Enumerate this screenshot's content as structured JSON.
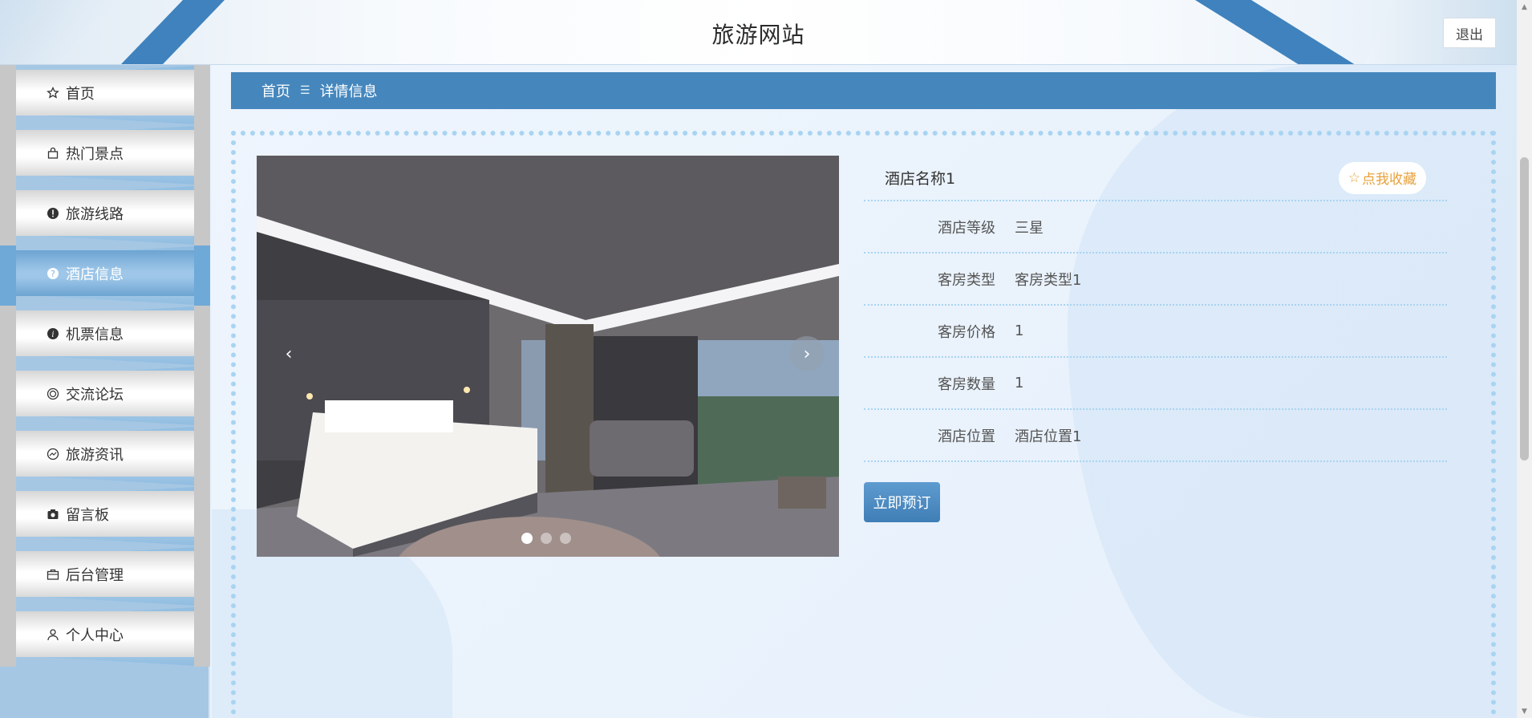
{
  "header": {
    "title": "旅游网站",
    "logout_label": "退出"
  },
  "sidebar": {
    "items": [
      {
        "label": "首页",
        "icon": "star-outline-icon",
        "active": false
      },
      {
        "label": "热门景点",
        "icon": "bag-icon",
        "active": false
      },
      {
        "label": "旅游线路",
        "icon": "exclamation-circle-icon",
        "active": false
      },
      {
        "label": "酒店信息",
        "icon": "question-circle-icon",
        "active": true
      },
      {
        "label": "机票信息",
        "icon": "info-circle-icon",
        "active": false
      },
      {
        "label": "交流论坛",
        "icon": "face-icon",
        "active": false
      },
      {
        "label": "旅游资讯",
        "icon": "chart-circle-icon",
        "active": false
      },
      {
        "label": "留言板",
        "icon": "camera-icon",
        "active": false
      },
      {
        "label": "后台管理",
        "icon": "briefcase-icon",
        "active": false
      },
      {
        "label": "个人中心",
        "icon": "user-icon",
        "active": false
      }
    ]
  },
  "breadcrumb": {
    "home": "首页",
    "separator": "☰",
    "current": "详情信息"
  },
  "carousel": {
    "prev": "‹",
    "next": "›",
    "slide_count": 3,
    "active_index": 0
  },
  "hotel": {
    "name": "酒店名称1",
    "favorite_label": "点我收藏",
    "favorite_star": "☆",
    "fields": [
      {
        "label": "酒店等级",
        "value": "三星"
      },
      {
        "label": "客房类型",
        "value": "客房类型1"
      },
      {
        "label": "客房价格",
        "value": "1"
      },
      {
        "label": "客房数量",
        "value": "1"
      },
      {
        "label": "酒店位置",
        "value": "酒店位置1"
      }
    ],
    "book_label": "立即预订"
  },
  "colors": {
    "accent": "#4587bd",
    "favorite": "#e8a13b",
    "border_dots": "#a8d4f2"
  }
}
